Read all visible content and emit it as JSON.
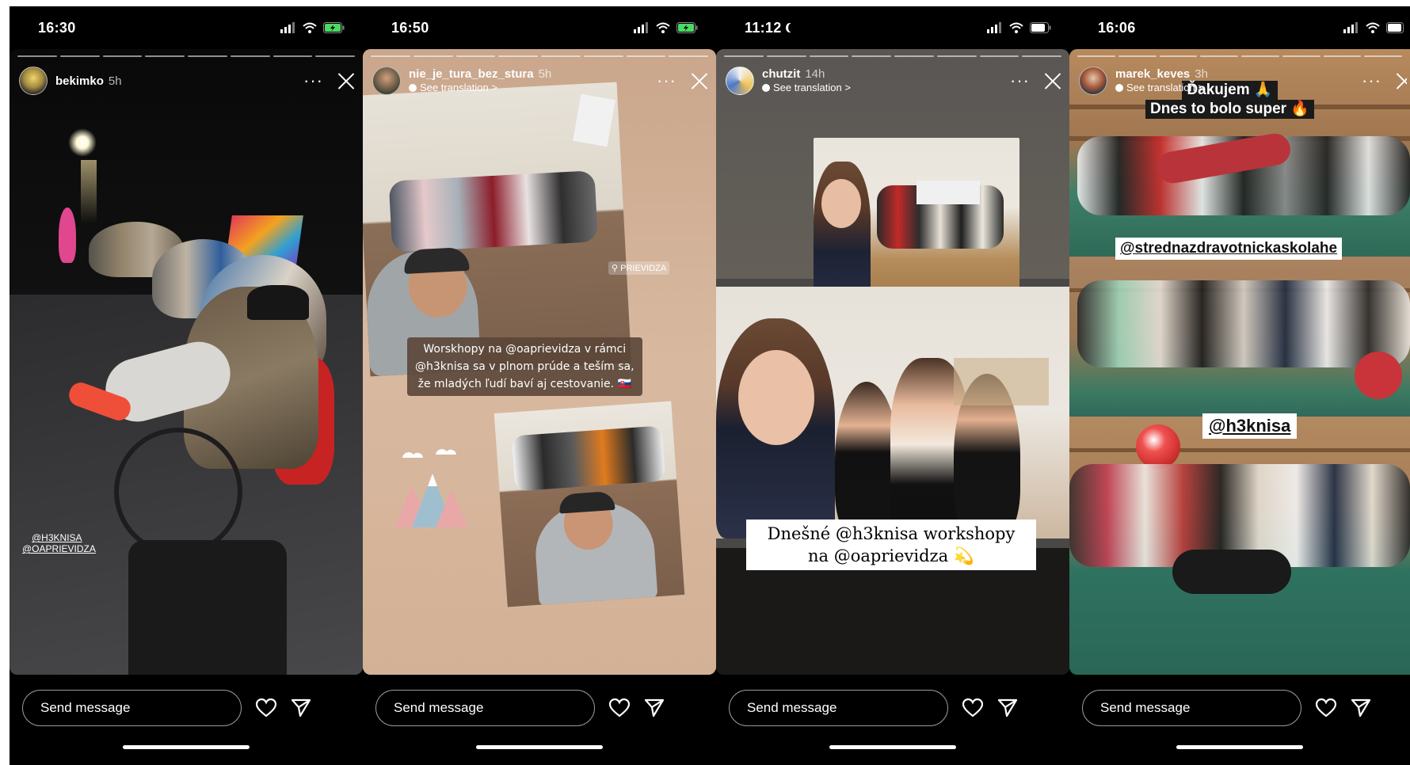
{
  "stories": [
    {
      "time": "16:30",
      "username": "bekimko",
      "age": "5h",
      "translation": "",
      "overlay_lines": [
        "@H3KNISA",
        "@OAPRIEVIDZA"
      ],
      "message_placeholder": "Send message"
    },
    {
      "time": "16:50",
      "username": "nie_je_tura_bez_stura",
      "age": "5h",
      "translation": "See translation >",
      "location_sticker": "⚲ PRIEVIDZA",
      "caption_lines": [
        "Worskhopy na @oaprievidza v rámci",
        "@h3knisa sa v plnom prúde a teším sa,",
        "že mladých ľudí baví aj cestovanie. 🇸🇰"
      ],
      "message_placeholder": "Send message"
    },
    {
      "time": "11:12",
      "username": "chutzit",
      "age": "14h",
      "translation": "See translation >",
      "caption_lines": [
        "Dnešné @h3knisa workshopy",
        "na @oaprievidza 💫"
      ],
      "message_placeholder": "Send message"
    },
    {
      "time": "16:06",
      "username": "marek_keves",
      "age": "3h",
      "translation": "See translation >",
      "top_lines": [
        "Ďakujem 🙏",
        "Dnes to bolo super 🔥"
      ],
      "mention_1": "@strednazdravotnickaskolahe",
      "mention_2": "@h3knisa",
      "message_placeholder": "Send message"
    }
  ],
  "icons": [
    "signal-icon",
    "wifi-icon",
    "battery-icon",
    "more-icon",
    "close-icon",
    "heart-icon",
    "send-icon"
  ],
  "colors": {
    "background": "#000000",
    "text": "#ffffff"
  }
}
